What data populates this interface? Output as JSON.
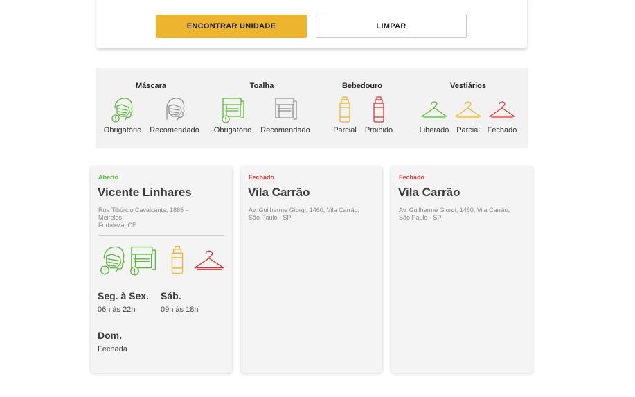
{
  "search": {
    "find_label": "ENCONTRAR UNIDADE",
    "clear_label": "LIMPAR"
  },
  "legend": {
    "groups": [
      {
        "title": "Máscara",
        "items": [
          "Obrigatório",
          "Recomendado"
        ],
        "icons": [
          "mask-required-icon",
          "mask-recommended-icon"
        ]
      },
      {
        "title": "Toalha",
        "items": [
          "Obrigatório",
          "Recomendado"
        ],
        "icons": [
          "towel-required-icon",
          "towel-recommended-icon"
        ]
      },
      {
        "title": "Bebedouro",
        "items": [
          "Parcial",
          "Proibido"
        ],
        "icons": [
          "water-bottle-partial-icon",
          "water-bottle-prohibited-icon"
        ]
      },
      {
        "title": "Vestiários",
        "items": [
          "Liberado",
          "Parcial",
          "Fechado"
        ],
        "icons": [
          "hanger-released-icon",
          "hanger-partial-icon",
          "hanger-closed-icon"
        ]
      }
    ]
  },
  "colors": {
    "accent": "#edb430",
    "green": "#5cb83c",
    "gray": "#8f8f8f",
    "yellow": "#edb430",
    "red": "#d9383a"
  },
  "cards": [
    {
      "status": "Aberto",
      "name": "Vicente Linhares",
      "address": [
        "Rua Tibúrcio Cavalcante, 1885 –",
        "Meireles",
        "Fortaleza, CE"
      ],
      "hours": [
        {
          "days": "Seg. à Sex.",
          "time": "06h às 22h"
        },
        {
          "days": "Sáb.",
          "time": "09h às 18h"
        },
        {
          "days": "Dom.",
          "time": "Fechada"
        }
      ]
    },
    {
      "status": "Fechado",
      "name": "Vila Carrão",
      "address": [
        "Av. Guilherme Giorgi, 1460, Vila Carrão,",
        "São Paulo - SP"
      ]
    },
    {
      "status": "Fechado",
      "name": "Vila Carrão",
      "address": [
        "Av. Guilherme Giorgi, 1460, Vila Carrão,",
        "São Paulo - SP"
      ]
    }
  ]
}
